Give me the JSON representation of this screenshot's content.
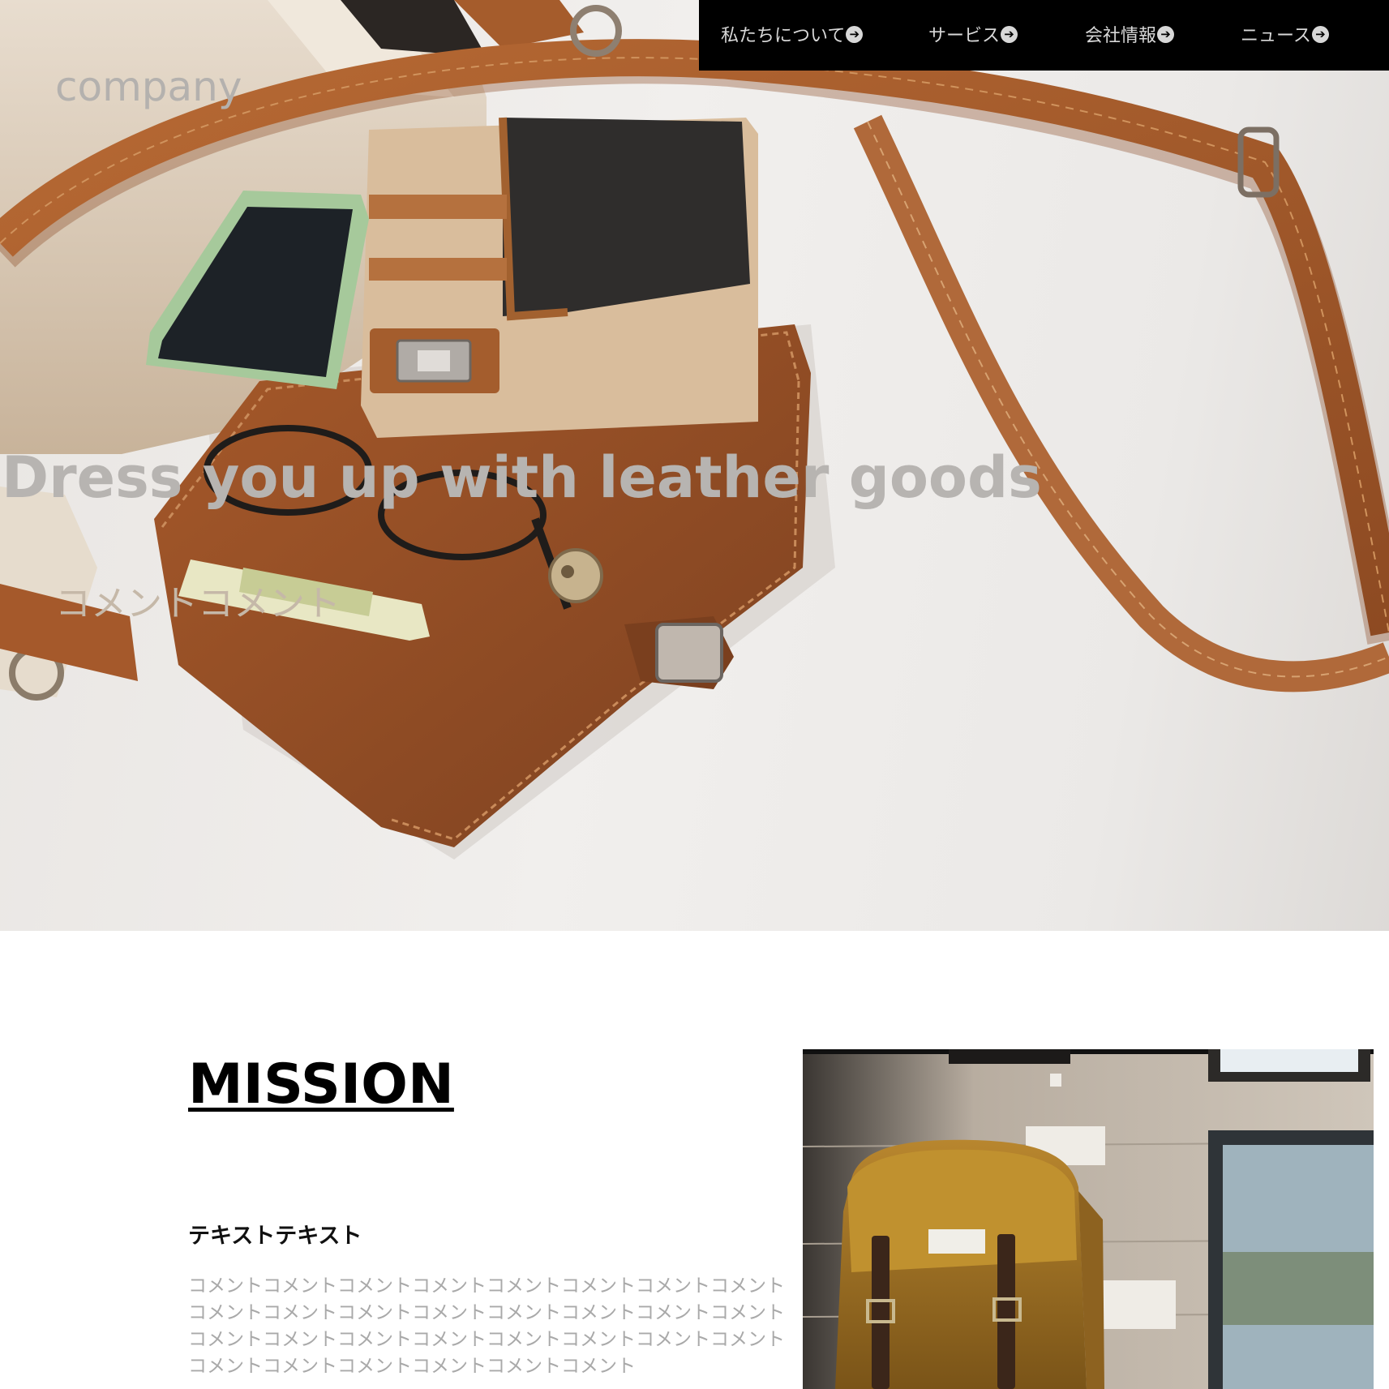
{
  "header": {
    "logo": "company",
    "nav": [
      {
        "label": "私たちについて",
        "icon": "arrow-circle-right-icon"
      },
      {
        "label": "サービス",
        "icon": "arrow-circle-right-icon"
      },
      {
        "label": "会社情報",
        "icon": "arrow-circle-right-icon"
      },
      {
        "label": "ニュース",
        "icon": "arrow-circle-right-icon"
      }
    ]
  },
  "hero": {
    "headline": "Dress you up with leather goods",
    "comment": "コメントコメント"
  },
  "mission": {
    "title": "MISSION",
    "subtitle": "テキストテキスト",
    "body_lines": [
      "コメントコメントコメントコメントコメントコメントコメントコメント",
      "コメントコメントコメントコメントコメントコメントコメントコメント",
      "コメントコメントコメントコメントコメントコメントコメントコメント",
      "コメントコメントコメントコメントコメントコメント"
    ]
  },
  "colors": {
    "nav_background": "#000000",
    "nav_text": "#d8d8d8",
    "leather_brown": "#a8612f",
    "headline_gray": "#b7b4b1"
  }
}
